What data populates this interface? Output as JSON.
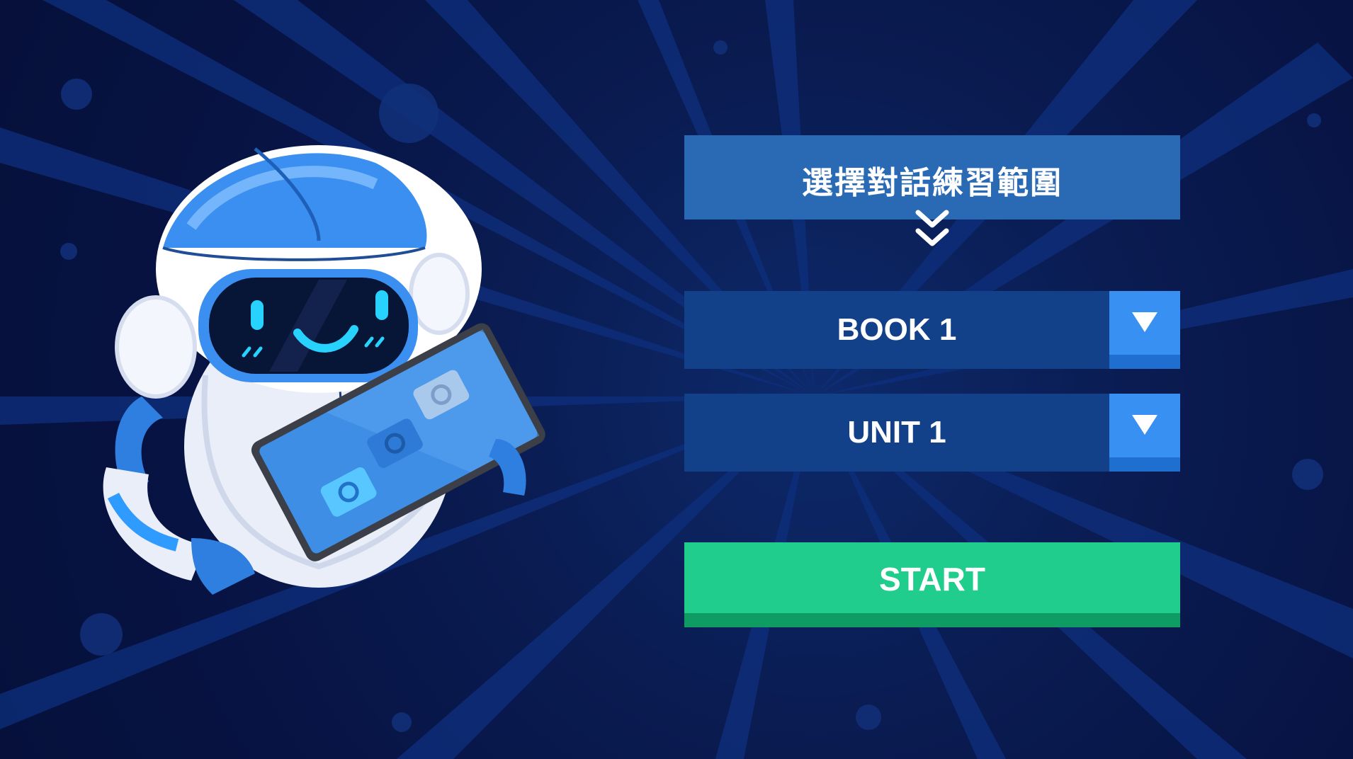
{
  "selector": {
    "title": "選擇對話練習範圍",
    "book": {
      "selected": "BOOK 1"
    },
    "unit": {
      "selected": "UNIT 1"
    },
    "start_label": "START"
  },
  "icons": {
    "chevrons": "double-chevron-down-icon",
    "caret": "caret-down-icon"
  },
  "colors": {
    "background": "#0a1c52",
    "title_bar": "#2a6ab5",
    "select_bg": "#134189",
    "caret_btn": "#3891f2",
    "start_btn": "#20cd8d"
  }
}
